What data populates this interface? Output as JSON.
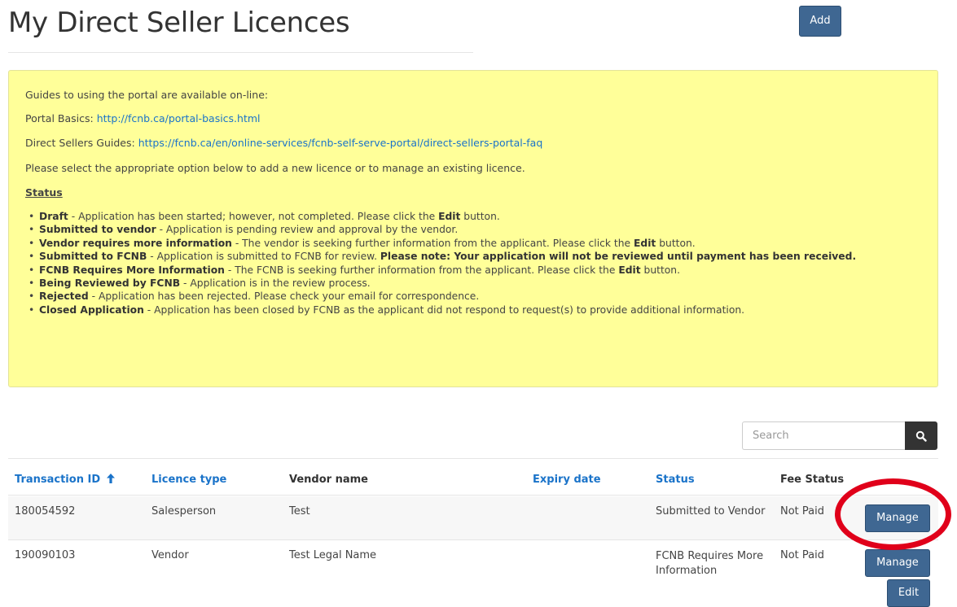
{
  "page": {
    "title": "My Direct Seller Licences",
    "add_label": "Add"
  },
  "info": {
    "intro": "Guides to using the portal are available on-line:",
    "portal_basics_label": "Portal Basics: ",
    "portal_basics_link": "http://fcnb.ca/portal-basics.html",
    "guides_label": "Direct Sellers Guides: ",
    "guides_link": "https://fcnb.ca/en/online-services/fcnb-self-serve-portal/direct-sellers-portal-faq",
    "instruction": "Please select the appropriate option below to add a new licence or to manage an existing licence.",
    "status_heading": "Status",
    "statuses": [
      {
        "term": "Draft",
        "desc": " - Application has been started; however, not completed. Please click the ",
        "bold2": "Edit",
        "tail": " button."
      },
      {
        "term": "Submitted to vendor",
        "desc": " - Application is pending review and approval by the vendor.",
        "bold2": "",
        "tail": ""
      },
      {
        "term": "Vendor requires more information",
        "desc": " - The vendor is seeking further information from the applicant. Please click the ",
        "bold2": "Edit",
        "tail": " button."
      },
      {
        "term": "Submitted to FCNB",
        "desc": " - Application is submitted to FCNB for review. ",
        "bold2": "Please note: Your application will not be reviewed until payment has been received.",
        "tail": ""
      },
      {
        "term": "FCNB Requires More Information",
        "desc": " - The FCNB is seeking further information from the applicant. Please click the ",
        "bold2": "Edit",
        "tail": " button."
      },
      {
        "term": "Being Reviewed by FCNB",
        "desc": " - Application is in the review process.",
        "bold2": "",
        "tail": ""
      },
      {
        "term": "Rejected",
        "desc": " - Application has been rejected. Please check your email for correspondence.",
        "bold2": "",
        "tail": ""
      },
      {
        "term": "Closed Application",
        "desc": " - Application has been closed by FCNB as the applicant did not respond to request(s) to provide additional information.",
        "bold2": "",
        "tail": ""
      }
    ]
  },
  "search": {
    "placeholder": "Search",
    "icon": "search-icon"
  },
  "table": {
    "columns": {
      "transaction_id": "Transaction ID",
      "licence_type": "Licence type",
      "vendor_name": "Vendor name",
      "expiry_date": "Expiry date",
      "status": "Status",
      "fee_status": "Fee Status"
    },
    "sort_icon": "arrow-up-icon",
    "rows": [
      {
        "transaction_id": "180054592",
        "licence_type": "Salesperson",
        "vendor_name": "Test",
        "expiry_date": "",
        "status": "Submitted to Vendor",
        "fee_status": "Not Paid",
        "manage_label": "Manage"
      },
      {
        "transaction_id": "190090103",
        "licence_type": "Vendor",
        "vendor_name": "Test Legal Name",
        "expiry_date": "",
        "status": "FCNB Requires More Information",
        "fee_status": "Not Paid",
        "manage_label": "Manage",
        "edit_label": "Edit"
      }
    ]
  },
  "colors": {
    "primary_button": "#3f6792",
    "info_background": "#ffff99",
    "link": "#1a73c9",
    "highlight": "#e0001a"
  }
}
